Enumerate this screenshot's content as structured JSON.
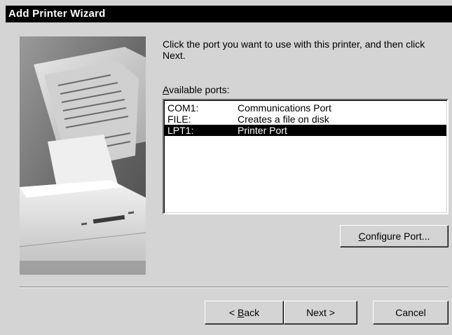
{
  "window": {
    "title": "Add Printer Wizard"
  },
  "instructions": "Click the port you want to use with this printer, and then click Next.",
  "ports": {
    "label_mnemonic": "A",
    "label_rest": "vailable ports:",
    "items": [
      {
        "name": "COM1:",
        "description": "Communications Port",
        "selected": false
      },
      {
        "name": "FILE:",
        "description": "Creates a file on disk",
        "selected": false
      },
      {
        "name": "LPT1:",
        "description": "Printer Port",
        "selected": true
      }
    ]
  },
  "buttons": {
    "configure_mnemonic": "C",
    "configure_rest": "onfigure Port...",
    "back_prefix": "< ",
    "back_mnemonic": "B",
    "back_rest": "ack",
    "next": "Next >",
    "cancel": "Cancel"
  },
  "colors": {
    "titlebar": "#000000",
    "dialog": "#d4d4d4",
    "selection": "#000000"
  }
}
